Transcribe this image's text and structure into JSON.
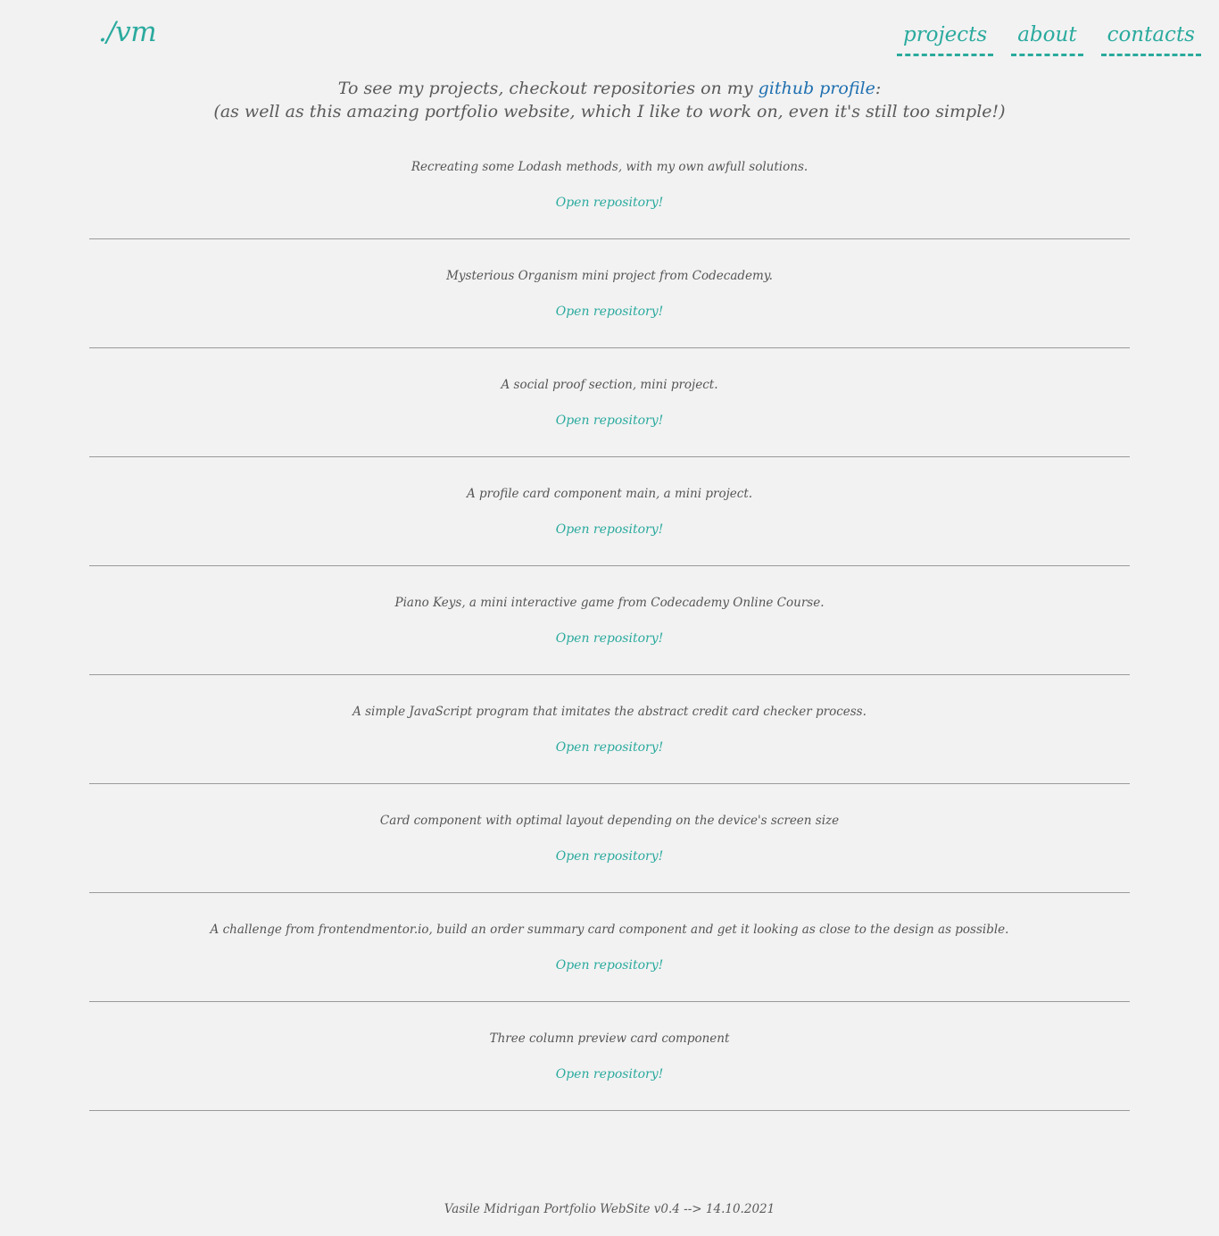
{
  "header": {
    "logo": "./vm",
    "nav": [
      {
        "label": "projects"
      },
      {
        "label": "about"
      },
      {
        "label": "contacts"
      }
    ]
  },
  "intro": {
    "line1_prefix": "To see my projects, checkout repositories on my ",
    "github_link": "github profile",
    "line1_suffix": ":",
    "line2": "(as well as this amazing portfolio website, which I like to work on, even it's still too simple!)"
  },
  "projects": [
    {
      "description": "Recreating some Lodash methods, with my own awfull solutions.",
      "link": "Open repository!"
    },
    {
      "description": "Mysterious Organism mini project from Codecademy.",
      "link": "Open repository!"
    },
    {
      "description": "A social proof section, mini project.",
      "link": "Open repository!"
    },
    {
      "description": "A profile card component main, a mini project.",
      "link": "Open repository!"
    },
    {
      "description": "Piano Keys, a mini interactive game from Codecademy Online Course.",
      "link": "Open repository!"
    },
    {
      "description": "A simple JavaScript program that imitates the abstract credit card checker process.",
      "link": "Open repository!"
    },
    {
      "description": "Card component with optimal layout depending on the device's screen size",
      "link": "Open repository!"
    },
    {
      "description": "A challenge from frontendmentor.io, build an order summary card component and get it looking as close to the design as possible.",
      "link": "Open repository!"
    },
    {
      "description": "Three column preview card component",
      "link": "Open repository!"
    }
  ],
  "footer": {
    "text": "Vasile Midrigan Portfolio WebSite v0.4 --> 14.10.2021"
  },
  "colors": {
    "background": "#f2f2f2",
    "accent": "#2aaa9e",
    "link": "#1e6fb0",
    "text": "#5a5a5a"
  }
}
